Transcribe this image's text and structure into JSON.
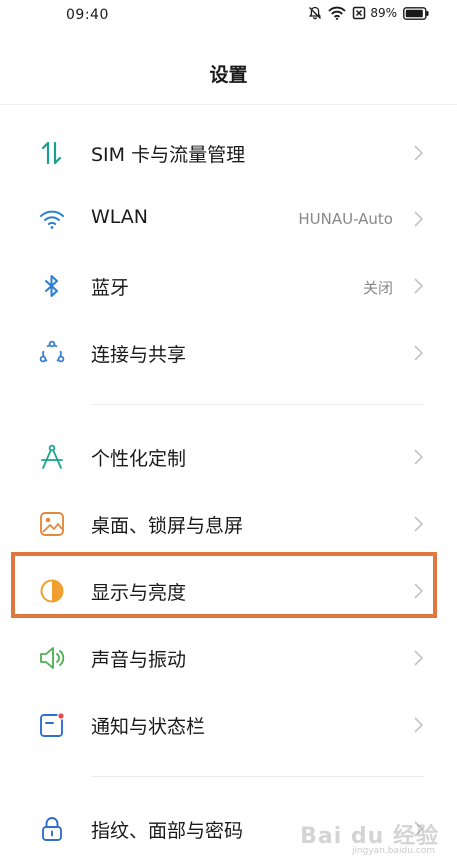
{
  "status_bar": {
    "time": "09:40",
    "battery": "89%",
    "icons": [
      "mute-bell-icon",
      "wifi-icon",
      "sim-card-icon",
      "battery-icon"
    ]
  },
  "header": {
    "title": "设置"
  },
  "menu": [
    {
      "label": "SIM 卡与流量管理",
      "value": "",
      "icon": "data-transfer-icon",
      "color": "#19a08a"
    },
    {
      "label": "WLAN",
      "value": "HUNAU-Auto",
      "icon": "wifi-icon",
      "color": "#2a7fd4"
    },
    {
      "label": "蓝牙",
      "value": "关闭",
      "icon": "bluetooth-icon",
      "color": "#2a7fd4"
    },
    {
      "label": "连接与共享",
      "value": "",
      "icon": "connection-share-icon",
      "color": "#3b7fd1"
    },
    {
      "label": "个性化定制",
      "value": "",
      "icon": "compass-icon",
      "color": "#1aa58f"
    },
    {
      "label": "桌面、锁屏与息屏",
      "value": "",
      "icon": "wallpaper-icon",
      "color": "#e38a3e"
    },
    {
      "label": "显示与亮度",
      "value": "",
      "icon": "brightness-icon",
      "color": "#f0a030"
    },
    {
      "label": "声音与振动",
      "value": "",
      "icon": "speaker-icon",
      "color": "#4caf50"
    },
    {
      "label": "通知与状态栏",
      "value": "",
      "icon": "notification-icon",
      "color": "#2f6fd0"
    },
    {
      "label": "指纹、面部与密码",
      "value": "",
      "icon": "lock-icon",
      "color": "#2f6fd0"
    }
  ],
  "watermark": {
    "text": "Bai du 经验",
    "sub": "jingyan.baidu.com"
  },
  "highlight_color": "#e0773f"
}
